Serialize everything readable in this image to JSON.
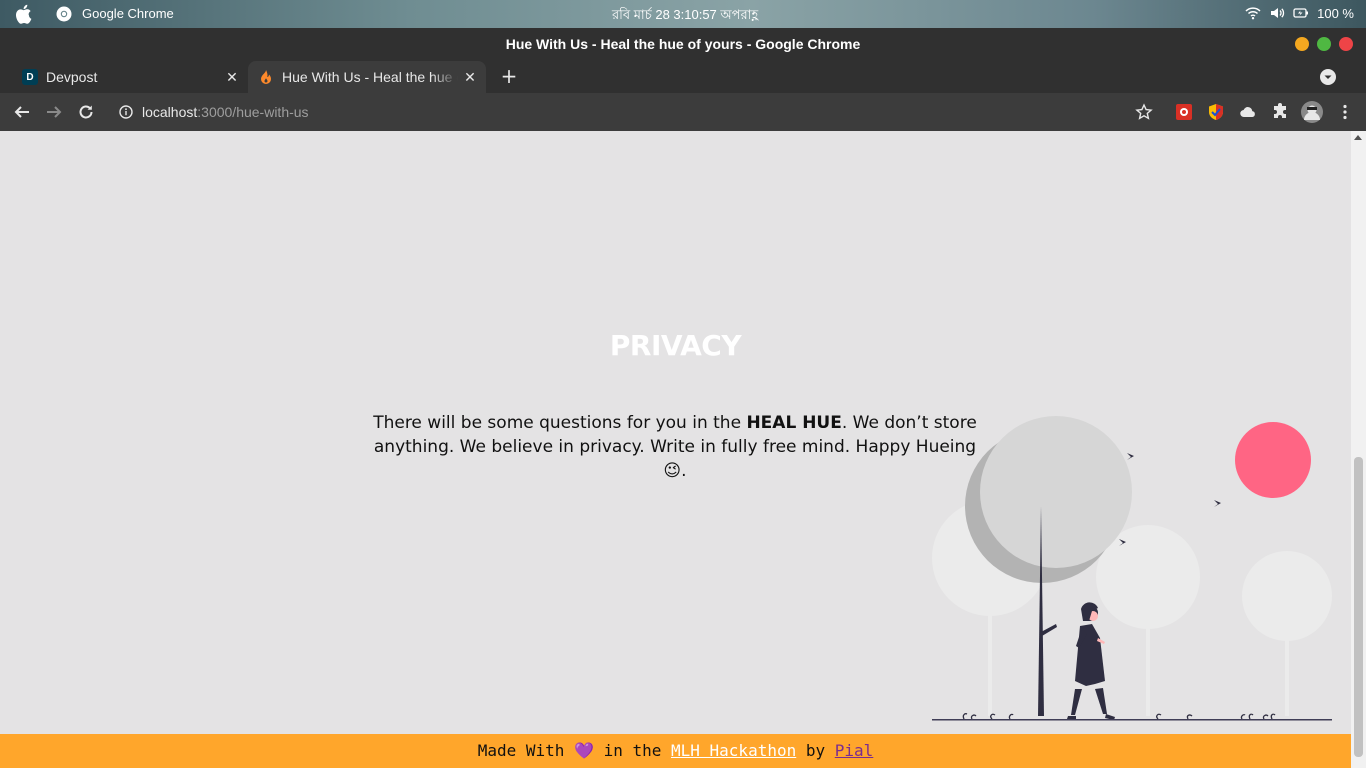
{
  "os": {
    "app_name": "Google Chrome",
    "clock": "রবি মার্চ 28   3:10:57 অপরাহ্ণ",
    "battery": "100 %"
  },
  "window": {
    "title": "Hue With Us - Heal the hue of yours - Google Chrome"
  },
  "tabs": [
    {
      "label": "Devpost",
      "favicon": "D",
      "active": false
    },
    {
      "label": "Hue With Us - Heal the hue of yours",
      "active": true
    }
  ],
  "toolbar": {
    "url_host": "localhost",
    "url_rest": ":3000/hue-with-us"
  },
  "page": {
    "heading": "PRIVACY",
    "text_before": "There will be some questions for you in the ",
    "text_bold": "HEAL HUE",
    "text_after": ". We don’t store anything. We believe in privacy. Write in fully free mind. Happy Hueing 😉."
  },
  "footer": {
    "made_with": "Made With ",
    "heart": "💜",
    "in_the": " in the ",
    "link1": "MLH Hackathon",
    "by": " by ",
    "link2": "Pial"
  },
  "colors": {
    "footer_bg": "#ffa62b",
    "page_bg": "#e4e3e4",
    "sun": "#ff6584",
    "figure": "#2f2e41"
  }
}
